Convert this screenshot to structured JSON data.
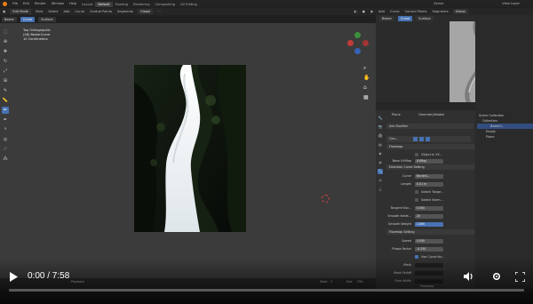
{
  "menubar": {
    "items": [
      "File",
      "Edit",
      "Render",
      "Window",
      "Help"
    ],
    "workspaces": [
      "Layout",
      "Default",
      "Shading",
      "Rendering",
      "Compositing",
      "UV Editing"
    ],
    "active_workspace": "Default",
    "scene": "Scene",
    "view_layer": "View Layer"
  },
  "viewport": {
    "mode": "Edit Mode",
    "menus": [
      "View",
      "Select",
      "Add",
      "Curve",
      "Control Points",
      "Segments"
    ],
    "orientation": "Global",
    "header_left_tabs": [
      "Bezier",
      "Curve",
      "Surface"
    ],
    "info_line1": "Top Orthographic",
    "info_line2": "(48) BezierCurve",
    "info_line3": "10 Centimeters"
  },
  "image_editor": {
    "tabs": [
      "Bezier",
      "Curve",
      "Surface"
    ],
    "menus": [
      "Add",
      "Curve",
      "Control Points",
      "Segments"
    ],
    "orientation": "Global"
  },
  "properties": {
    "object_name": "Plane",
    "modifier_tab": "GeometryNodes",
    "add_modifier": "Add Modifier",
    "modifier_name": "Geo...",
    "panel_title": "Flowmap",
    "object_in_xy": "Object In XY...",
    "base_uvmap_label": "Base UVMap",
    "base_uvmap_value": "UVMap",
    "direction_section": "Direction Curve Setting",
    "curve_label": "Curve",
    "curve_value": "BezierC...",
    "length_label": "Length",
    "length_value": "0.01 m",
    "switch_tangent": "Switch Tange...",
    "switch_normal": "Switch Norm...",
    "tangent_label": "Tangent Nor...",
    "tangent_value": "0.000",
    "smooth_iter_label": "Smooth Iterat...",
    "smooth_iter_value": "20",
    "smooth_weight_label": "Smooth Weight",
    "smooth_weight_value": "1.000",
    "flowmap_section": "Flowmap Setting",
    "speed_label": "Speed",
    "speed_value": "0.050",
    "phase_label": "Phase Factor",
    "phase_value": "-0.250",
    "use_curve_label": "Use Curve for...",
    "mask_label": "Mask",
    "mask_falloff_label": "Mask Falloff",
    "flow_width_label": "Flow Width",
    "flowmap_footer": "Flowmap",
    "tab_color": "#4772b3"
  },
  "outliner": {
    "title": "Scene Collection",
    "items": [
      "Collection",
      "BezierC...",
      "Empty",
      "Plane"
    ]
  },
  "timeline": {
    "playback": "Playback",
    "start_label": "Start",
    "start_value": "1",
    "end_label": "End",
    "end_value": "250"
  },
  "video": {
    "time": "0:00 / 7:58",
    "progress": 0.0,
    "accent": "#ff0000"
  }
}
